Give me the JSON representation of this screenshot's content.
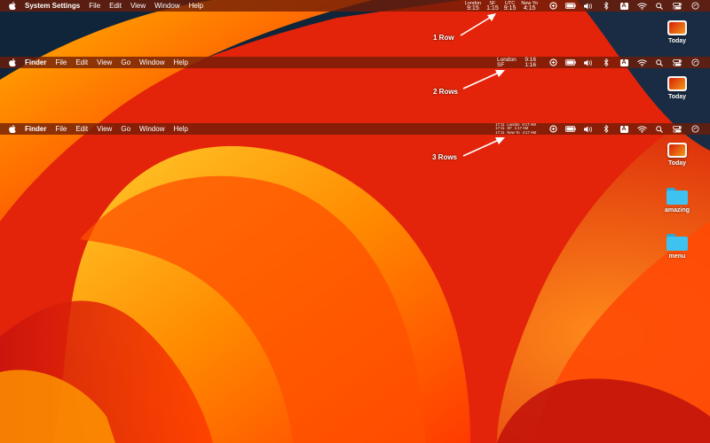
{
  "bar1": {
    "app_name": "System Settings",
    "menus": [
      "File",
      "Edit",
      "View",
      "Window",
      "Help"
    ],
    "clocks": [
      {
        "label": "London",
        "time": "9:15"
      },
      {
        "label": "SF",
        "time": "1:15"
      },
      {
        "label": "UTC",
        "time": "9:15"
      },
      {
        "label": "New Yo",
        "time": "4:15"
      }
    ]
  },
  "bar2": {
    "app_name": "Finder",
    "menus": [
      "File",
      "Edit",
      "View",
      "Go",
      "Window",
      "Help"
    ],
    "clocks": [
      {
        "city": "London",
        "time": "9:16"
      },
      {
        "city": "SF",
        "time": "1:16"
      }
    ]
  },
  "bar3": {
    "app_name": "Finder",
    "menus": [
      "File",
      "Edit",
      "View",
      "Go",
      "Window",
      "Help"
    ],
    "clocks": [
      {
        "a": "17:11",
        "city": "London",
        "time": "9:17 AM"
      },
      {
        "a": "17:11",
        "city": "SF",
        "time": "1:17 AM"
      },
      {
        "a": "17:11",
        "city": "New Yo",
        "time": "4:17 AM"
      }
    ]
  },
  "status_icons": [
    "sync-icon",
    "battery-icon",
    "volume-icon",
    "bluetooth-icon",
    "input-source-icon",
    "wifi-icon",
    "search-icon",
    "control-center-icon",
    "siri-icon"
  ],
  "input_source_letter": "A",
  "annotations": {
    "one_row": "1 Row",
    "two_rows": "2 Rows",
    "three_rows": "3 Rows"
  },
  "desktop": {
    "today_label": "Today",
    "folder_amazing": "amazing",
    "folder_menu": "menu"
  }
}
